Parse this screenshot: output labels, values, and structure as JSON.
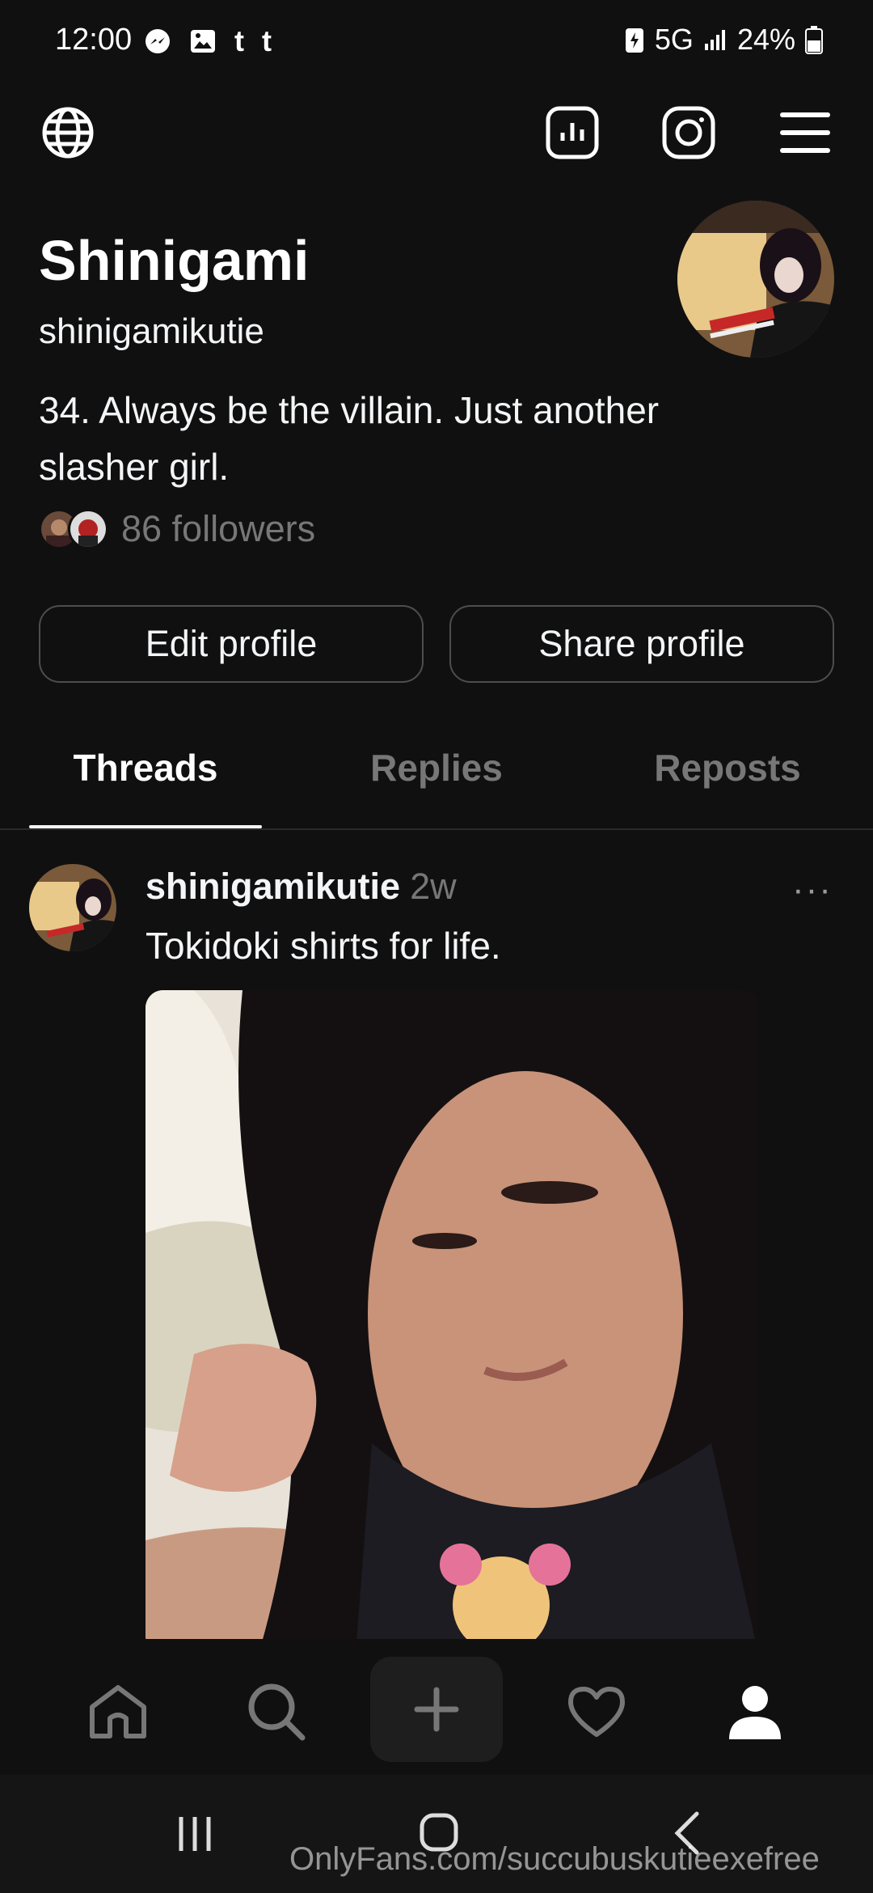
{
  "status_bar": {
    "time": "12:00",
    "icons_left": [
      "messenger-icon",
      "gallery-icon",
      "tumblr-icon",
      "tumblr-icon"
    ],
    "network": "5G",
    "battery": "24%"
  },
  "top_bar": {
    "icons": [
      "globe-icon",
      "insights-icon",
      "instagram-icon",
      "menu-icon"
    ]
  },
  "profile": {
    "name": "Shinigami",
    "handle": "shinigamikutie",
    "bio": "34. Always be the villain. Just another slasher girl.",
    "followers_text": "86 followers",
    "edit_button": "Edit profile",
    "share_button": "Share profile"
  },
  "tabs": [
    {
      "label": "Threads",
      "active": true
    },
    {
      "label": "Replies",
      "active": false
    },
    {
      "label": "Reposts",
      "active": false
    }
  ],
  "post": {
    "username": "shinigamikutie",
    "time": "2w",
    "text": "Tokidoki shirts for life.",
    "more": "···"
  },
  "bottom_nav": [
    "home-icon",
    "search-icon",
    "create-icon",
    "activity-icon",
    "profile-icon"
  ],
  "watermark": "OnlyFans.com/succubuskutieexefree",
  "colors": {
    "background": "#101010",
    "text": "#f3f5f7",
    "muted": "#777777",
    "border": "#4d4d4d"
  }
}
